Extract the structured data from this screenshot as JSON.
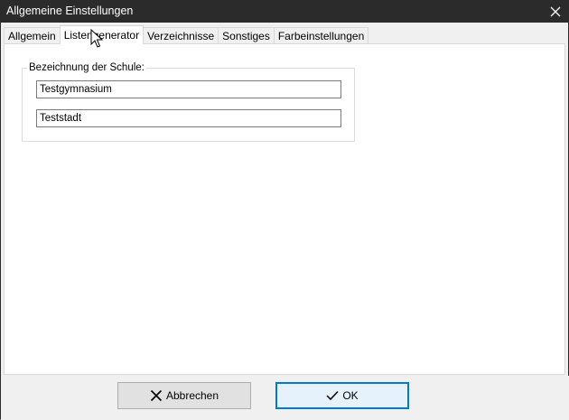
{
  "window": {
    "title": "Allgemeine Einstellungen",
    "close_icon": "close-icon"
  },
  "tabs": [
    {
      "label": "Allgemein",
      "active": false
    },
    {
      "label": "Listengenerator",
      "active": true
    },
    {
      "label": "Verzeichnisse",
      "active": false
    },
    {
      "label": "Sonstiges",
      "active": false
    },
    {
      "label": "Farbeinstellungen",
      "active": false
    }
  ],
  "school_group": {
    "legend": "Bezeichnung der Schule:",
    "name_value": "Testgymnasium",
    "city_value": "Teststadt"
  },
  "buttons": {
    "cancel_label": "Abbrechen",
    "cancel_icon": "x-icon",
    "ok_label": "OK",
    "ok_icon": "checkmark-icon"
  },
  "colors": {
    "titlebar": "#2b2b2b",
    "default_button_border": "#0078d7"
  }
}
